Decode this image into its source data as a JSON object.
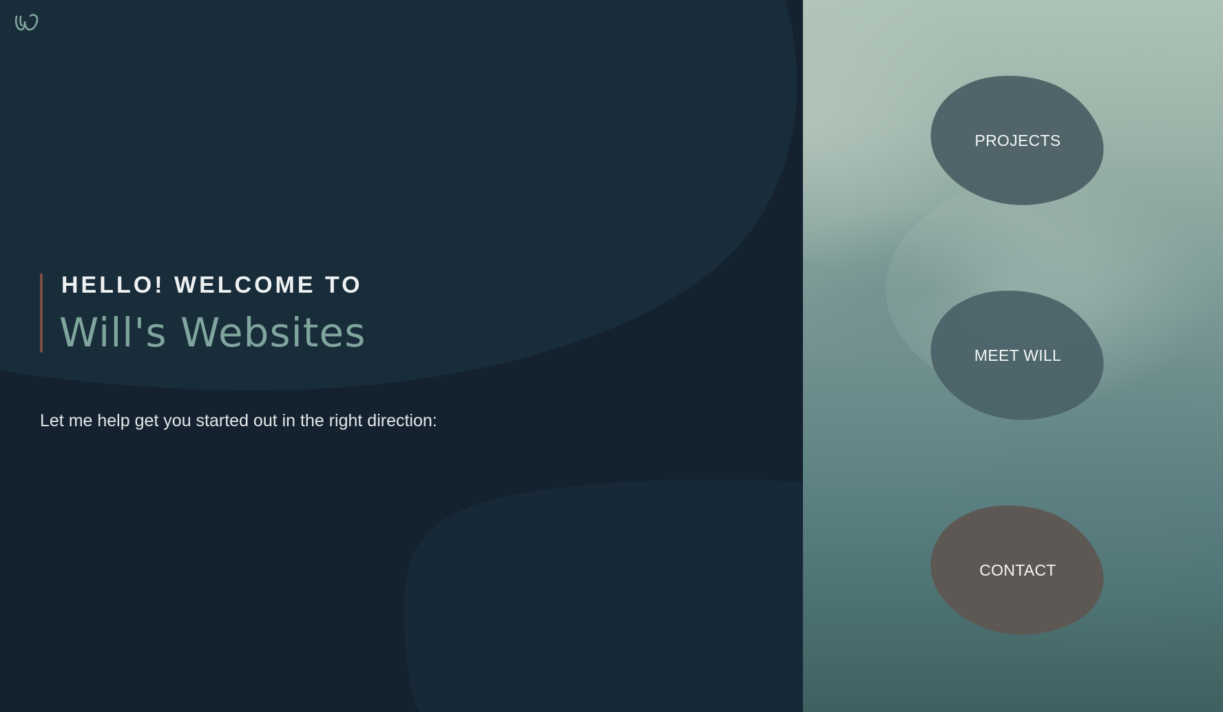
{
  "logo": {
    "icon": "w-logo-icon",
    "color": "#7fa69d"
  },
  "hero": {
    "greeting": "HELLO! WELCOME TO",
    "brand": "Will's Websites",
    "tagline": "Let me help get you started out in the right direction:"
  },
  "nav": {
    "items": [
      {
        "label": "PROJECTS",
        "color": "#4a5e64"
      },
      {
        "label": "MEET WILL",
        "color": "#4a6267"
      },
      {
        "label": "CONTACT",
        "color": "#5e5652"
      }
    ]
  },
  "colors": {
    "left_background": "#14222f",
    "accent_bar": "#7d4f45",
    "brand_text": "#7fa69d",
    "heading_text": "#eef1f2"
  }
}
